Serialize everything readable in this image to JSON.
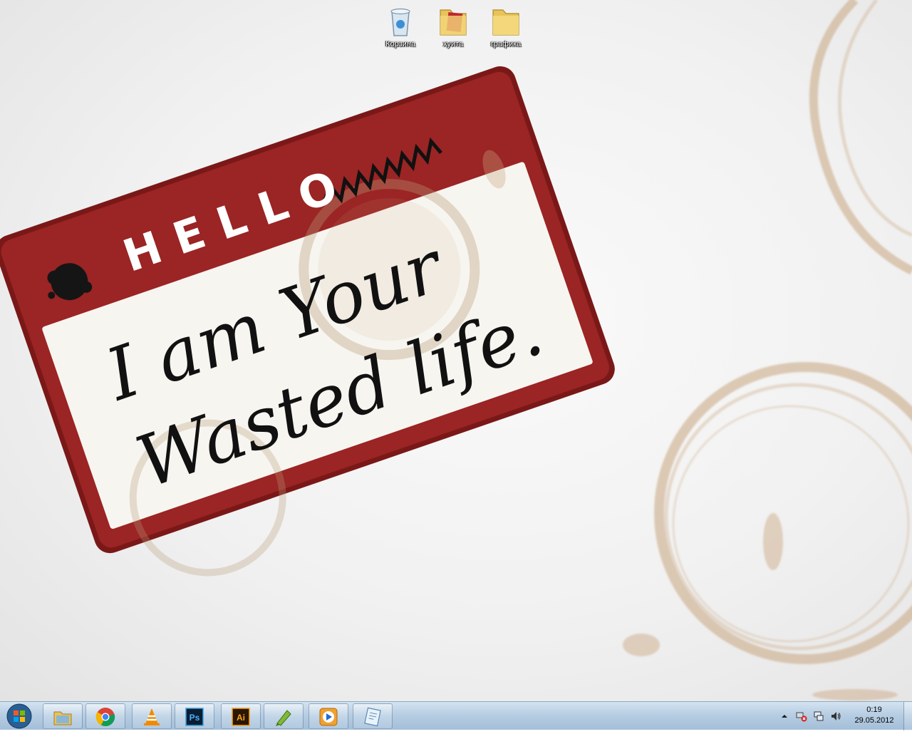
{
  "desktop_icons": [
    {
      "label": "Корзина",
      "icon": "recycle-bin-icon"
    },
    {
      "label": "хуита",
      "icon": "folder-icon"
    },
    {
      "label": "графика",
      "icon": "folder-icon"
    }
  ],
  "wallpaper": {
    "badge_header": "HELLO",
    "badge_line1": "I am Your",
    "badge_line2": "Wasted life."
  },
  "taskbar": {
    "start_icon": "windows-start-icon",
    "pinned": [
      {
        "name": "explorer",
        "icon": "explorer-icon"
      },
      {
        "name": "chrome",
        "icon": "chrome-icon"
      },
      {
        "name": "vlc",
        "icon": "vlc-icon"
      },
      {
        "name": "photoshop",
        "icon": "photoshop-icon",
        "text": "Ps"
      },
      {
        "name": "illustrator",
        "icon": "illustrator-icon",
        "text": "Ai"
      },
      {
        "name": "corel",
        "icon": "pen-app-icon"
      },
      {
        "name": "media-player",
        "icon": "media-player-icon"
      },
      {
        "name": "notepad",
        "icon": "notepad-icon"
      }
    ],
    "tray": {
      "show_hidden_icon": "chevron-up-icon",
      "icons": [
        "network-error-icon",
        "action-center-icon",
        "volume-icon"
      ],
      "time": "0:19",
      "date": "29.05.2012"
    }
  },
  "colors": {
    "badge_red": "#9b2424",
    "badge_border": "#7a1818",
    "coffee_stain": "#c9a57f",
    "taskbar": "#b4cce2"
  }
}
